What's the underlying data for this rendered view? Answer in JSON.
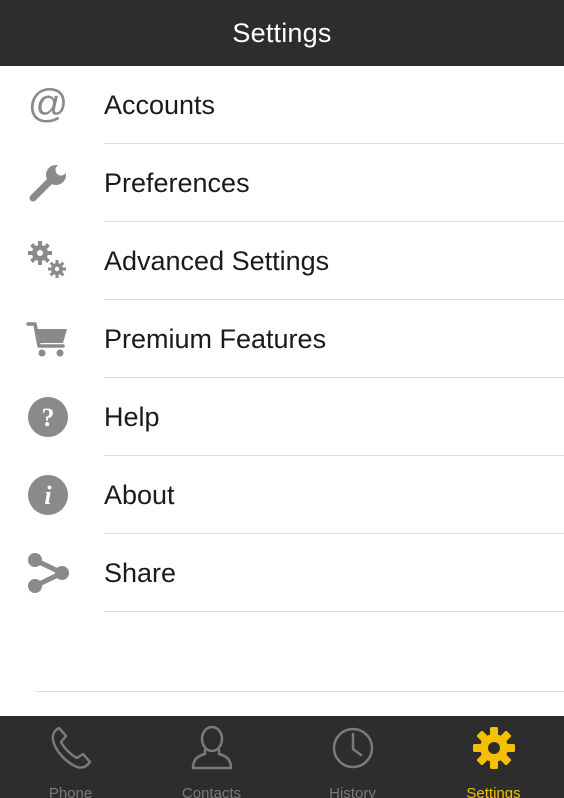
{
  "header": {
    "title": "Settings"
  },
  "menu": {
    "items": [
      {
        "label": "Accounts",
        "icon": "at-sign-icon"
      },
      {
        "label": "Preferences",
        "icon": "wrench-icon"
      },
      {
        "label": "Advanced Settings",
        "icon": "gears-icon"
      },
      {
        "label": "Premium Features",
        "icon": "shopping-cart-icon"
      },
      {
        "label": "Help",
        "icon": "question-icon"
      },
      {
        "label": "About",
        "icon": "info-icon"
      },
      {
        "label": "Share",
        "icon": "share-icon"
      }
    ]
  },
  "tabbar": {
    "tabs": [
      {
        "label": "Phone",
        "icon": "phone-icon"
      },
      {
        "label": "Contacts",
        "icon": "contacts-icon"
      },
      {
        "label": "History",
        "icon": "clock-icon"
      },
      {
        "label": "Settings",
        "icon": "gear-icon",
        "active": true
      }
    ]
  },
  "colors": {
    "header_bg": "#2d2d2d",
    "tabbar_bg": "#2d2d2d",
    "active_tab": "#f5c000",
    "inactive_tab": "#7a7a7a",
    "icon_gray": "#8a8a8a",
    "divider": "#dcdcdc"
  }
}
